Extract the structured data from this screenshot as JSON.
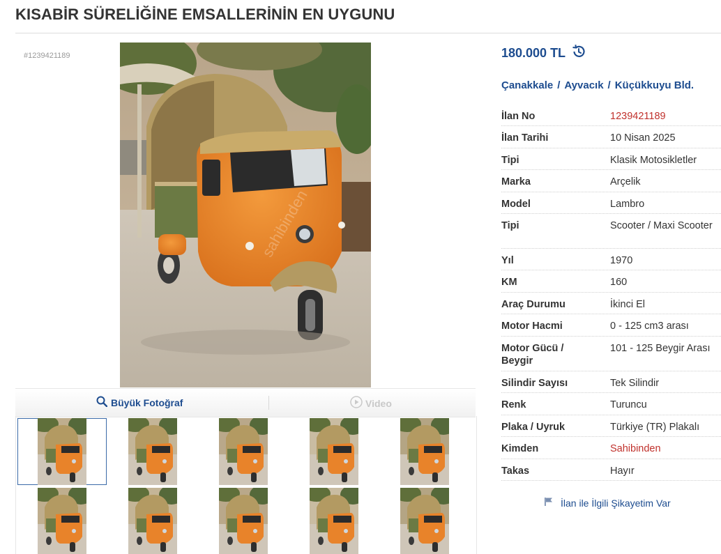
{
  "page": {
    "title": "KISABİR SÜRELİĞİNE EMSALLERİNİN EN UYGUNU",
    "listing_id_label": "#1239421189"
  },
  "gallery": {
    "big_photo_label": "Büyük Fotoğraf",
    "video_label": "Video",
    "thumbnail_count": 10,
    "active_thumbnail": 1
  },
  "listing": {
    "price": "180.000 TL",
    "location": {
      "city": "Çanakkale",
      "district": "Ayvacık",
      "neighborhood": "Küçükkuyu Bld.",
      "separator": "/"
    },
    "details": [
      {
        "label": "İlan No",
        "value": "1239421189"
      },
      {
        "label": "İlan Tarihi",
        "value": "10 Nisan 2025"
      },
      {
        "label": "Tipi",
        "value": "Klasik Motosikletler"
      },
      {
        "label": "Marka",
        "value": "Arçelik"
      },
      {
        "label": "Model",
        "value": "Lambro"
      },
      {
        "label": "Tipi",
        "value": "Scooter / Maxi Scooter"
      },
      {
        "label": "Yıl",
        "value": "1970"
      },
      {
        "label": "KM",
        "value": "160"
      },
      {
        "label": "Araç Durumu",
        "value": "İkinci El"
      },
      {
        "label": "Motor Hacmi",
        "value": "0 - 125 cm3 arası"
      },
      {
        "label": "Motor Gücü / Beygir",
        "value": "101 - 125 Beygir Arası"
      },
      {
        "label": "Silindir Sayısı",
        "value": "Tek Silindir"
      },
      {
        "label": "Renk",
        "value": "Turuncu"
      },
      {
        "label": "Plaka / Uyruk",
        "value": "Türkiye (TR) Plakalı"
      },
      {
        "label": "Kimden",
        "value": "Sahibinden"
      },
      {
        "label": "Takas",
        "value": "Hayır"
      }
    ],
    "report_label": "İlan ile İlgili Şikayetim Var"
  },
  "icons": {
    "price_history": "history-icon",
    "search": "magnifier-icon",
    "video": "play-circle-icon",
    "report": "flag-icon"
  },
  "colors": {
    "link_blue": "#1d4c8f",
    "highlight_red": "#c0312c",
    "vehicle_orange": "#e8832a",
    "canopy_tan": "#b39a62",
    "cargo_green": "#6b7a44"
  }
}
